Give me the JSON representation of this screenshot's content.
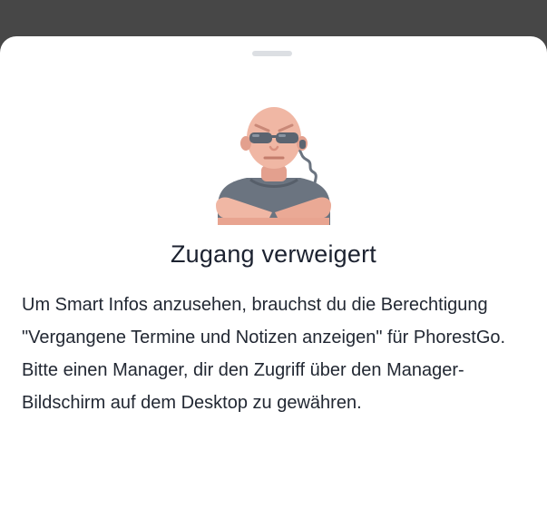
{
  "dialog": {
    "title": "Zugang verweigert",
    "message": "Um Smart Infos anzusehen, brauchst du die Berechtigung \"Vergangene Termine und Notizen anzeigen\" für PhorestGo. Bitte einen Manager, dir den Zugriff über den Manager-Bildschirm auf dem Desktop zu gewähren.",
    "illustration_icon": "security-guard-icon"
  },
  "colors": {
    "backdrop": "#474747",
    "sheet": "#ffffff",
    "title": "#1c2230",
    "text": "#222833",
    "grabber": "#dcdfe3",
    "skin": "#f0b7a4",
    "shirt": "#6b7480",
    "glasses": "#5b6470"
  }
}
